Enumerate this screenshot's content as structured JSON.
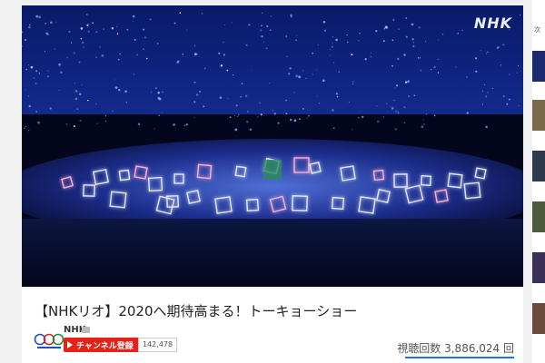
{
  "video": {
    "title": "【NHKリオ】2020へ期待高まる！トーキョーショー",
    "watermark": "NHK"
  },
  "channel": {
    "name": "NHK",
    "subscribe_label": "チャンネル登録",
    "subscriber_count": "142,478"
  },
  "stats": {
    "views": "視聴回数 3,886,024 回"
  },
  "sidebar": {
    "heading": "次"
  },
  "colors": {
    "subscribe": "#e62117",
    "accent": "#1a73e8",
    "stage_glow": "#6e8cff"
  }
}
